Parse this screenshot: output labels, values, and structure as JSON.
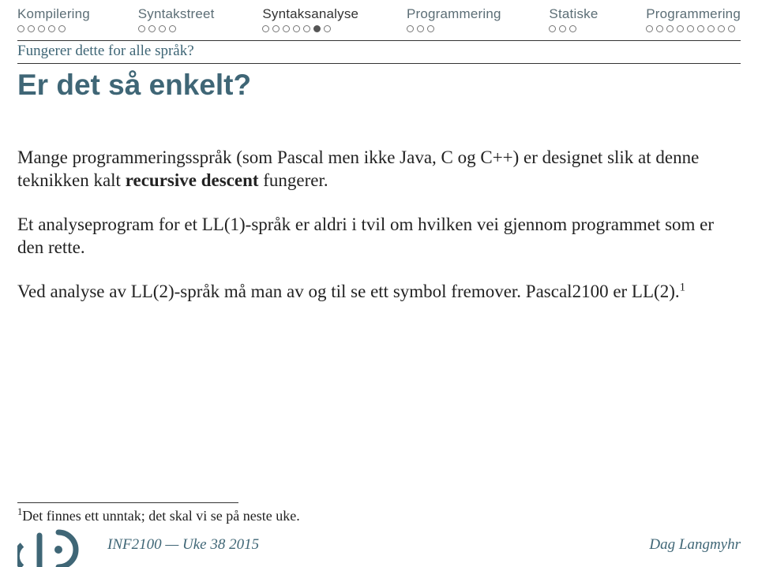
{
  "nav": {
    "items": [
      {
        "label": "Kompilering",
        "dots": 5,
        "active_dot": -1
      },
      {
        "label": "Syntakstreet",
        "dots": 4,
        "active_dot": -1
      },
      {
        "label": "Syntaksanalyse",
        "dots": 7,
        "active_dot": 5
      },
      {
        "label": "Programmering",
        "dots": 3,
        "active_dot": -1
      },
      {
        "label": "Statiske",
        "dots": 3,
        "active_dot": -1
      },
      {
        "label": "Programmering",
        "dots": 9,
        "active_dot": -1
      }
    ]
  },
  "section_label": "Fungerer dette for alle språk?",
  "title": "Er det så enkelt?",
  "body": {
    "p1a": "Mange programmeringsspråk (som Pascal men ikke Java, C og C++) er designet slik at denne teknikken kalt ",
    "p1b": "recursive descent",
    "p1c": " fungerer.",
    "p2": "Et analyseprogram for et LL(1)-språk er aldri i tvil om hvilken vei gjennom programmet som er den rette.",
    "p3a": "Ved analyse av LL(2)-språk må man av og til se ett symbol fremover. Pascal2100 er LL(2).",
    "p3sup": "1"
  },
  "footnote": {
    "num": "1",
    "text": "Det finnes ett unntak; det skal vi se på neste uke."
  },
  "footer": {
    "course": "INF2100 — Uke 38 2015",
    "author": "Dag Langmyhr"
  },
  "colors": {
    "accent": "#3f6676"
  }
}
